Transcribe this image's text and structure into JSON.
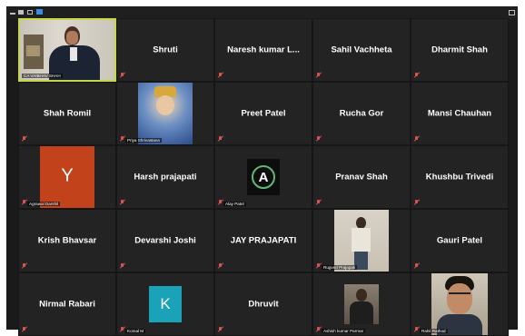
{
  "colors": {
    "active_speaker": "#c7d64a",
    "y_avatar": "#c2421c",
    "k_avatar": "#1aa3b8",
    "mic_muted": "#d9534f"
  },
  "participants": [
    {
      "name": "",
      "caption": "CA VAIBHAV SHAH",
      "type": "video"
    },
    {
      "name": "Shruti"
    },
    {
      "name": "Naresh kumar L..."
    },
    {
      "name": "Sahil Vachheta"
    },
    {
      "name": "Dharmit Shah"
    },
    {
      "name": "Shah Romil"
    },
    {
      "name": "",
      "caption": "Priya Shrivastava",
      "type": "photo"
    },
    {
      "name": "Preet Patel"
    },
    {
      "name": "Rucha Gor"
    },
    {
      "name": "Mansi Chauhan"
    },
    {
      "name": "",
      "caption": "Agrawal Darshil",
      "type": "letter",
      "letter": "Y"
    },
    {
      "name": "Harsh prajapati"
    },
    {
      "name": "",
      "caption": "Alay Patel",
      "type": "logo",
      "letter": "A"
    },
    {
      "name": "Pranav Shah"
    },
    {
      "name": "Khushbu Trivedi"
    },
    {
      "name": "Krish Bhavsar"
    },
    {
      "name": "Devarshi Joshi"
    },
    {
      "name": "JAY PRAJAPATI"
    },
    {
      "name": "",
      "caption": "Rugved Prajapati",
      "type": "photo"
    },
    {
      "name": "Gauri Patel"
    },
    {
      "name": "Nirmal Rabari"
    },
    {
      "name": "",
      "caption": "Komal M",
      "type": "letter",
      "letter": "K"
    },
    {
      "name": "Dhruvit"
    },
    {
      "name": "",
      "caption": "Ashish kumar Parmar",
      "type": "photo"
    },
    {
      "name": "",
      "caption": "Rahil Rathod",
      "type": "video"
    }
  ]
}
